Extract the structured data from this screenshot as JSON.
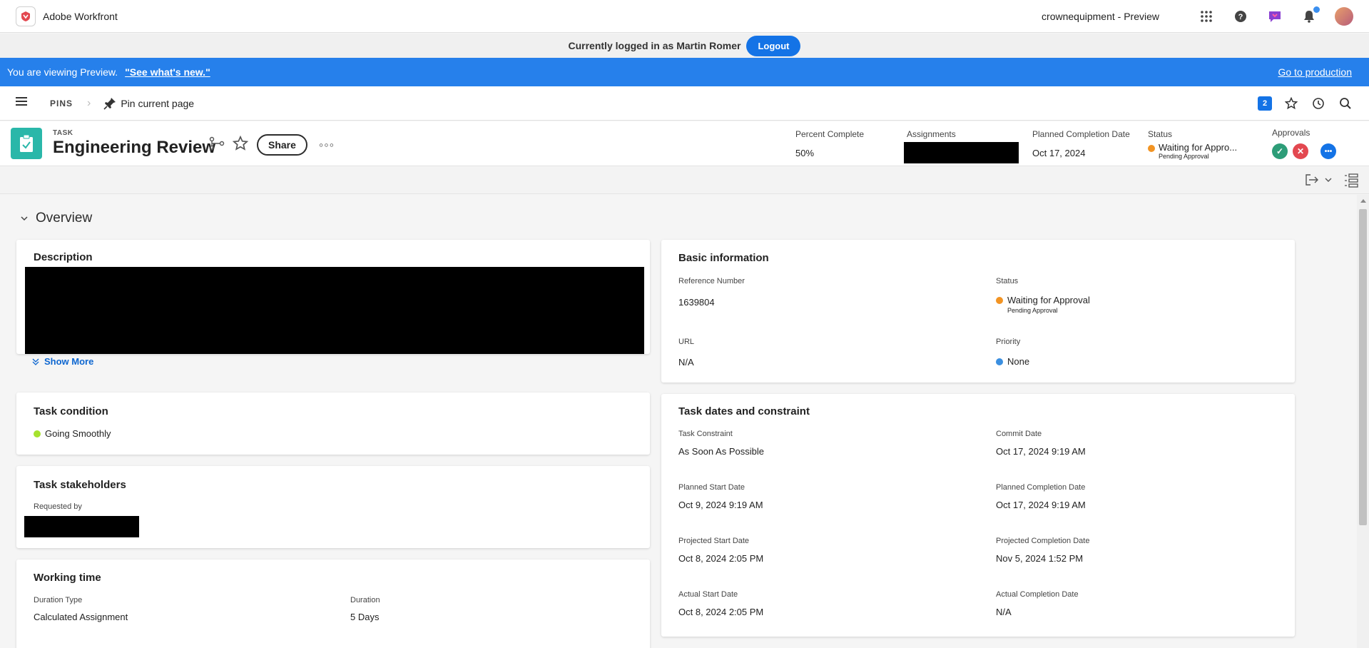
{
  "topbar": {
    "app_title": "Adobe Workfront",
    "tenant": "crownequipment - Preview",
    "icons": [
      "workfront-logo-icon",
      "app-grid-icon",
      "help-icon",
      "feedback-icon",
      "notifications-icon",
      "avatar"
    ]
  },
  "loginbar": {
    "text": "Currently logged in as Martin Romer",
    "logout_label": "Logout"
  },
  "preview": {
    "text": "You are viewing Preview.",
    "link": "\"See what's new.\"",
    "production_link": "Go to production"
  },
  "pinsbar": {
    "pins_label": "PINS",
    "pin_current": "Pin current page",
    "badge_count": "2"
  },
  "task": {
    "type": "TASK",
    "name": "Engineering Review",
    "share_label": "Share",
    "more_label": "◦◦◦",
    "percent_label": "Percent Complete",
    "percent_value": "50%",
    "assignments_label": "Assignments",
    "planned_completion_label": "Planned Completion Date",
    "planned_completion_value": "Oct 17, 2024",
    "status_label": "Status",
    "status_value": "Waiting for Appro...",
    "status_sub": "Pending Approval",
    "approvals_label": "Approvals",
    "status_color": "#f29423"
  },
  "overview": {
    "title": "Overview",
    "description": {
      "title": "Description",
      "show_more": "Show More"
    },
    "basic": {
      "title": "Basic information",
      "ref_label": "Reference Number",
      "ref_value": "1639804",
      "status_label": "Status",
      "status_value": "Waiting for Approval",
      "status_sub": "Pending Approval",
      "url_label": "URL",
      "url_value": "N/A",
      "priority_label": "Priority",
      "priority_value": "None"
    },
    "condition": {
      "title": "Task condition",
      "value": "Going Smoothly",
      "color": "#a6e22e"
    },
    "stakeholders": {
      "title": "Task stakeholders",
      "requested_by_label": "Requested by"
    },
    "working_time": {
      "title": "Working time",
      "duration_type_label": "Duration Type",
      "duration_type_value": "Calculated Assignment",
      "duration_label": "Duration",
      "duration_value": "5 Days"
    },
    "dates": {
      "title": "Task dates and constraint",
      "constraint_label": "Task Constraint",
      "constraint_value": "As Soon As Possible",
      "commit_label": "Commit Date",
      "commit_value": "Oct 17, 2024 9:19 AM",
      "planned_start_label": "Planned Start Date",
      "planned_start_value": "Oct 9, 2024 9:19 AM",
      "planned_completion_label": "Planned Completion Date",
      "planned_completion_value": "Oct 17, 2024 9:19 AM",
      "projected_start_label": "Projected Start Date",
      "projected_start_value": "Oct 8, 2024 2:05 PM",
      "projected_completion_label": "Projected Completion Date",
      "projected_completion_value": "Nov 5, 2024 1:52 PM",
      "actual_start_label": "Actual Start Date",
      "actual_start_value": "Oct 8, 2024 2:05 PM",
      "actual_completion_label": "Actual Completion Date",
      "actual_completion_value": "N/A"
    }
  }
}
